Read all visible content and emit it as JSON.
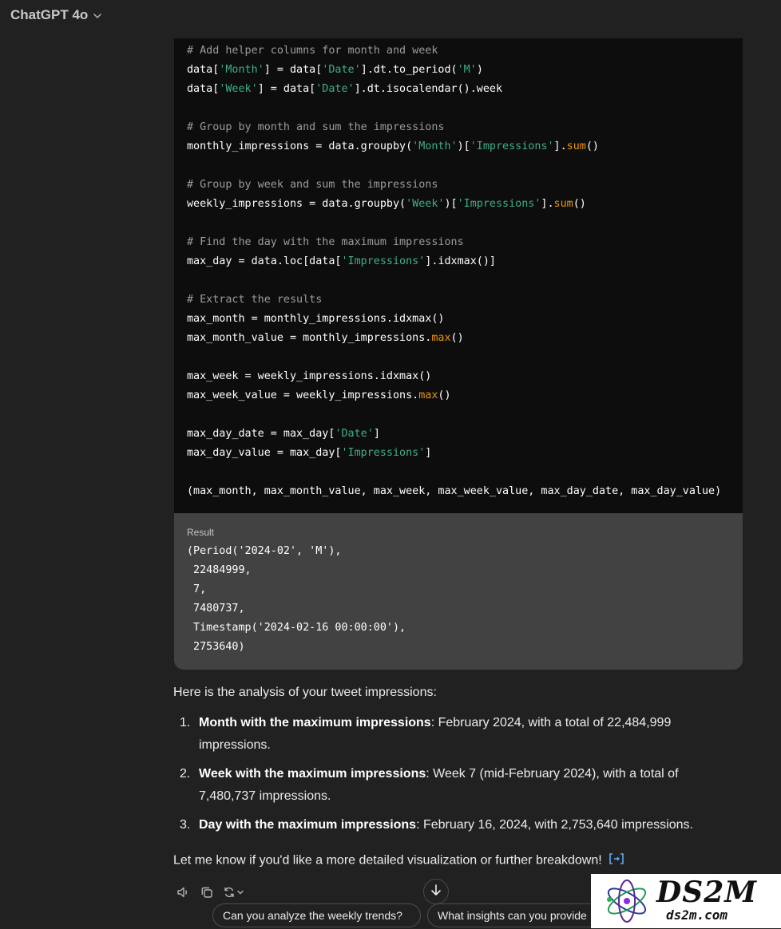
{
  "header": {
    "title": "ChatGPT 4o"
  },
  "code_lines": [
    [
      {
        "t": "# Add helper columns for month and week",
        "c": "com"
      }
    ],
    [
      {
        "t": "data["
      },
      {
        "t": "'Month'",
        "c": "str"
      },
      {
        "t": "] = data["
      },
      {
        "t": "'Date'",
        "c": "str"
      },
      {
        "t": "].dt.to_period("
      },
      {
        "t": "'M'",
        "c": "str"
      },
      {
        "t": ")"
      }
    ],
    [
      {
        "t": "data["
      },
      {
        "t": "'Week'",
        "c": "str"
      },
      {
        "t": "] = data["
      },
      {
        "t": "'Date'",
        "c": "str"
      },
      {
        "t": "].dt.isocalendar().week"
      }
    ],
    [],
    [
      {
        "t": "# Group by month and sum the impressions",
        "c": "com"
      }
    ],
    [
      {
        "t": "monthly_impressions = data.groupby("
      },
      {
        "t": "'Month'",
        "c": "str"
      },
      {
        "t": ")["
      },
      {
        "t": "'Impressions'",
        "c": "str"
      },
      {
        "t": "]."
      },
      {
        "t": "sum",
        "c": "fn"
      },
      {
        "t": "()"
      }
    ],
    [],
    [
      {
        "t": "# Group by week and sum the impressions",
        "c": "com"
      }
    ],
    [
      {
        "t": "weekly_impressions = data.groupby("
      },
      {
        "t": "'Week'",
        "c": "str"
      },
      {
        "t": ")["
      },
      {
        "t": "'Impressions'",
        "c": "str"
      },
      {
        "t": "]."
      },
      {
        "t": "sum",
        "c": "fn"
      },
      {
        "t": "()"
      }
    ],
    [],
    [
      {
        "t": "# Find the day with the maximum impressions",
        "c": "com"
      }
    ],
    [
      {
        "t": "max_day = data.loc[data["
      },
      {
        "t": "'Impressions'",
        "c": "str"
      },
      {
        "t": "].idxmax()]"
      }
    ],
    [],
    [
      {
        "t": "# Extract the results",
        "c": "com"
      }
    ],
    [
      {
        "t": "max_month = monthly_impressions.idxmax()"
      }
    ],
    [
      {
        "t": "max_month_value = monthly_impressions."
      },
      {
        "t": "max",
        "c": "fn"
      },
      {
        "t": "()"
      }
    ],
    [],
    [
      {
        "t": "max_week = weekly_impressions.idxmax()"
      }
    ],
    [
      {
        "t": "max_week_value = weekly_impressions."
      },
      {
        "t": "max",
        "c": "fn"
      },
      {
        "t": "()"
      }
    ],
    [],
    [
      {
        "t": "max_day_date = max_day["
      },
      {
        "t": "'Date'",
        "c": "str"
      },
      {
        "t": "]"
      }
    ],
    [
      {
        "t": "max_day_value = max_day["
      },
      {
        "t": "'Impressions'",
        "c": "str"
      },
      {
        "t": "]"
      }
    ],
    [],
    [
      {
        "t": "(max_month, max_month_value, max_week, max_week_value, max_day_date, max_day_value)"
      }
    ]
  ],
  "result": {
    "label": "Result",
    "output": "(Period('2024-02', 'M'),\n 22484999,\n 7,\n 7480737,\n Timestamp('2024-02-16 00:00:00'),\n 2753640)"
  },
  "answer": {
    "intro": "Here is the analysis of your tweet impressions:",
    "items": [
      {
        "num": "1.",
        "bold": "Month with the maximum impressions",
        "text": ": February 2024, with a total of 22,484,999 impressions."
      },
      {
        "num": "2.",
        "bold": "Week with the maximum impressions",
        "text": ": Week 7 (mid-February 2024), with a total of 7,480,737 impressions."
      },
      {
        "num": "3.",
        "bold": "Day with the maximum impressions",
        "text": ": February 16, 2024, with 2,753,640 impressions."
      }
    ],
    "outro": "Let me know if you'd like a more detailed visualization or further breakdown!"
  },
  "actions": [
    "speaker-icon",
    "copy-icon",
    "regenerate-icon"
  ],
  "suggestions": [
    "Can you analyze the weekly trends?",
    "What insights can you provide"
  ],
  "watermark": {
    "brand": "DS2M",
    "url": "ds2m.com"
  },
  "colors": {
    "background": "#212121",
    "code_bg": "#0d0d0d",
    "result_bg": "#424242",
    "string": "#3fae8c",
    "comment": "#9c9c9c",
    "builtin": "#e9950c"
  }
}
